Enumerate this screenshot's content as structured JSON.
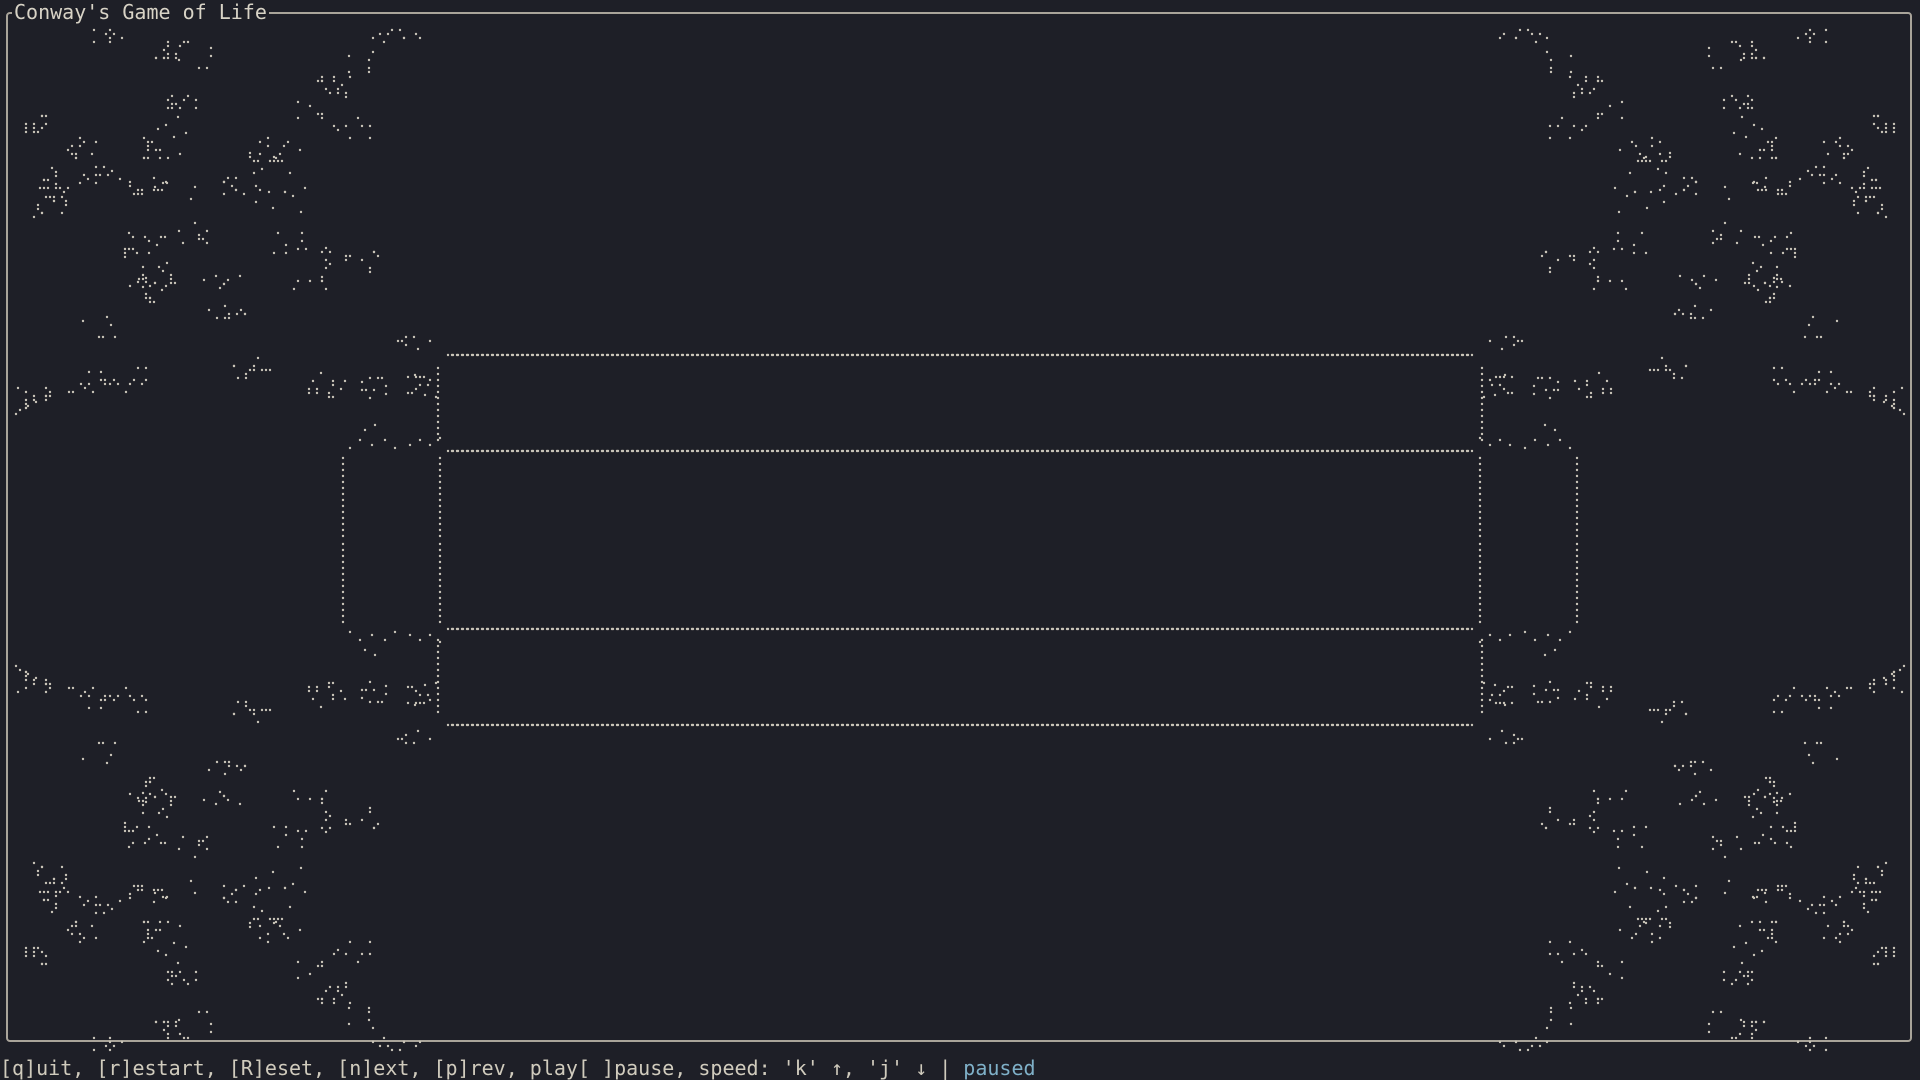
{
  "window": {
    "title": "Conway's Game of Life"
  },
  "controls": {
    "text": "[q]uit, [r]estart, [R]eset, [n]ext, [p]rev, play[ ]pause, speed: 'k' ↑, 'j' ↓ | ",
    "state": "paused"
  },
  "colors": {
    "background": "#1e1f27",
    "cell": "#c9c4b8",
    "border": "#a9a49a",
    "state": "#7fb0c8"
  },
  "board": {
    "symmetry": "four-fold mirror",
    "inner_pattern": "dotted rectangular ring"
  }
}
